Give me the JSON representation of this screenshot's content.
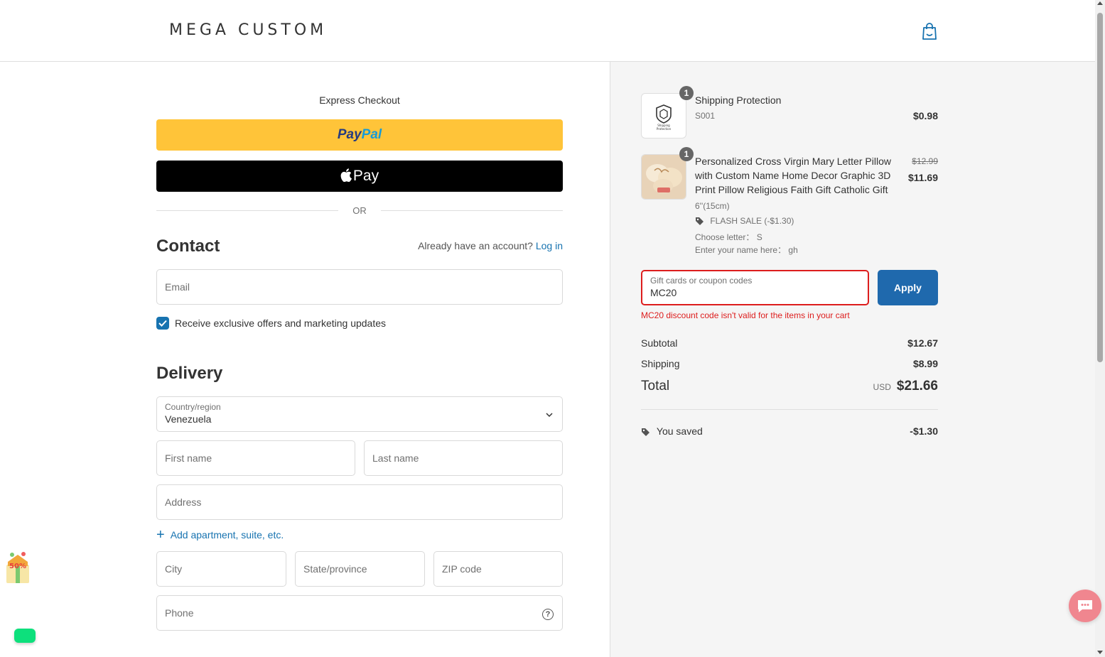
{
  "header": {
    "logo": "MEGA CUSTOM",
    "cart_icon": "shopping-bag-icon"
  },
  "express": {
    "title": "Express Checkout",
    "paypal_part1": "Pay",
    "paypal_part2": "Pal",
    "applepay_label": "Pay",
    "or_text": "OR"
  },
  "contact": {
    "title": "Contact",
    "account_prompt": "Already have an account?",
    "login_link": "Log in",
    "email_placeholder": "Email",
    "marketing_label": "Receive exclusive offers and marketing updates",
    "marketing_checked": true
  },
  "delivery": {
    "title": "Delivery",
    "country_label": "Country/region",
    "country_value": "Venezuela",
    "first_name_placeholder": "First name",
    "last_name_placeholder": "Last name",
    "address_placeholder": "Address",
    "add_apartment": "Add apartment, suite, etc.",
    "city_placeholder": "City",
    "state_placeholder": "State/province",
    "zip_placeholder": "ZIP code",
    "phone_placeholder": "Phone"
  },
  "order": {
    "items": [
      {
        "qty": "1",
        "title": "Shipping Protection",
        "sku": "S001",
        "price": "$0.98",
        "thumb_text": "Shipping Protection"
      },
      {
        "qty": "1",
        "title_line1": "Personalized Cross Virgin Mary Letter Pillow",
        "title_line2": "with Custom Name Home Decor Graphic 3D",
        "title_line3": "Print Pillow Religious Faith Gift Catholic Gift",
        "variant": "6''(15cm)",
        "discount": "FLASH SALE (-$1.30)",
        "option1": "Choose letter： S",
        "option2": "Enter your name here： gh",
        "original_price": "$12.99",
        "price": "$11.69"
      }
    ],
    "coupon_label": "Gift cards or coupon codes",
    "coupon_value": "MC20",
    "apply_label": "Apply",
    "coupon_error": "MC20 discount code isn't valid for the items in your cart",
    "subtotal_label": "Subtotal",
    "subtotal_value": "$12.67",
    "shipping_label": "Shipping",
    "shipping_value": "$8.99",
    "total_label": "Total",
    "currency": "USD",
    "total_value": "$21.66",
    "saved_label": "You saved",
    "saved_value": "-$1.30"
  },
  "widgets": {
    "gift_badge": "50%",
    "chat_icon": "chat-bubble-icon"
  },
  "colors": {
    "accent": "#1773b0",
    "apply_button": "#1f69ad",
    "paypal": "#ffc439",
    "error": "#dd1d1d",
    "chat": "#f0868f"
  }
}
